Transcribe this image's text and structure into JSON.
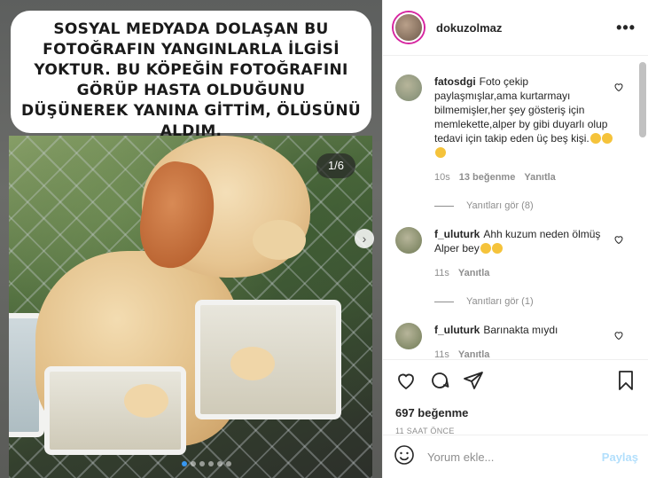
{
  "media": {
    "caption": "SOSYAL MEDYADA DOLAŞAN BU FOTOĞRAFIN YANGINLARLA İLGİSİ YOKTUR. BU KÖPEĞİN FOTOĞRAFINI GÖRÜP HASTA OLDUĞUNU DÜŞÜNEREK YANINA GİTTİM, ÖLÜSÜNÜ ALDIM.",
    "counter": "1/6",
    "slide_count": 6,
    "current_slide": 1
  },
  "post": {
    "username": "dokuzolmaz",
    "more_label": "•••"
  },
  "comments": [
    {
      "username": "fatosdgi",
      "text": "Foto çekip paylaşmışlar,ama kurtarmayı bilmemişler,her şey gösteriş için memlekette,alper by gibi duyarlı olup tedavi için takip eden üç beş kişi.",
      "emoji_count": 3,
      "time": "10s",
      "likes": "13 beğenme",
      "reply_label": "Yanıtla",
      "view_replies": "Yanıtları gör (8)",
      "avatar_color": "#7d8a72"
    },
    {
      "username": "f_uluturk",
      "text": "Ahh kuzum neden ölmüş Alper bey",
      "emoji_count": 2,
      "time": "11s",
      "likes": "",
      "reply_label": "Yanıtla",
      "view_replies": "Yanıtları gör (1)",
      "avatar_color": "#6f7a55"
    },
    {
      "username": "f_uluturk",
      "text": "Barınakta mıydı",
      "emoji_count": 0,
      "time": "11s",
      "likes": "",
      "reply_label": "Yanıtla",
      "view_replies": "",
      "avatar_color": "#6f7a55"
    }
  ],
  "actions": {
    "likes": "697 beğenme",
    "time": "11 SAAT ÖNCE"
  },
  "add_comment": {
    "placeholder": "Yorum ekle...",
    "post_label": "Paylaş"
  },
  "colors": {
    "link_blue_disabled": "#b2dffc",
    "muted": "#8e8e8e",
    "text": "#262626"
  }
}
